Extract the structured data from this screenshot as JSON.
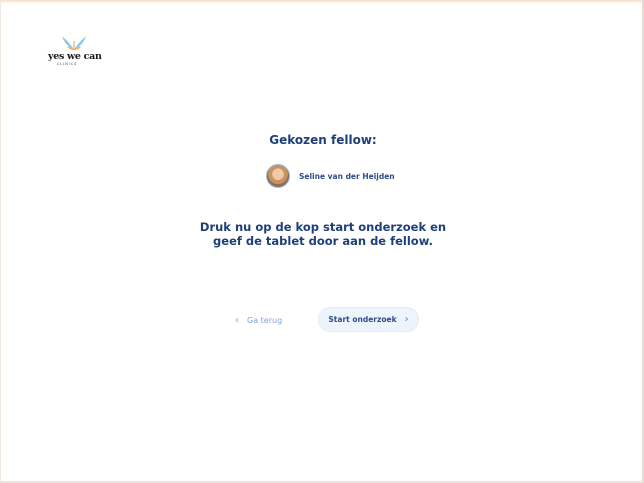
{
  "brand": {
    "name": "yes we can",
    "sub": "CLINICS"
  },
  "heading": "Gekozen fellow:",
  "fellow": {
    "name": "Seline van der Heijden"
  },
  "instruction": {
    "line1": "Druk nu op de kop start onderzoek en",
    "line2": "geef de tablet door aan de fellow."
  },
  "actions": {
    "back_label": "Ga terug",
    "start_label": "Start onderzoek"
  },
  "icons": {
    "back": "chevron-left-icon",
    "forward": "chevron-right-icon"
  },
  "colors": {
    "primary_text": "#1e3f7a",
    "link": "#7fa3d6",
    "button_bg": "#eef4fc"
  }
}
